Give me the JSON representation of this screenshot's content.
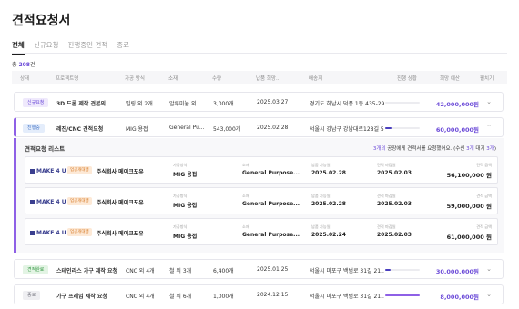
{
  "page": {
    "title": "견적요청서"
  },
  "tabs": [
    {
      "label": "전체",
      "active": true
    },
    {
      "label": "신규요청",
      "active": false
    },
    {
      "label": "진행중인 견적",
      "active": false
    },
    {
      "label": "종료",
      "active": false
    }
  ],
  "summary": {
    "prefix": "총 ",
    "count": "208",
    "suffix": "건"
  },
  "columns": [
    "상태",
    "프로젝트명",
    "가공 방식",
    "소재",
    "수량",
    "납품 희망...",
    "배송지",
    "진행 상황",
    "희망 예산",
    "펼치기"
  ],
  "rows": [
    {
      "status": "신규요청",
      "status_kind": "new",
      "project": "3D 드론 제작 견본의",
      "method": "밀링 외 2개",
      "material": "알루미늄 외...",
      "qty": "3,000개",
      "date": "2025.03.27",
      "address": "경기도 하남시 덕풍 1동 435-29...",
      "progress": 0.0,
      "progress_color": "#ececf0",
      "budget": "42,000,000원",
      "chevron": "⌄"
    },
    {
      "status": "진행중",
      "status_kind": "prog",
      "project": "레진/CNC 견적요청",
      "method": "MIG 용접",
      "material": "General Pu...",
      "qty": "543,000개",
      "date": "2025.02.28",
      "address": "서울시 강남구 강남대로128길 5...",
      "progress": 0.18,
      "progress_color": "#4a3fbf",
      "budget": "60,000,000원",
      "chevron": "⌃"
    },
    {
      "status": "견적완료",
      "status_kind": "done",
      "project": "스테인리스 가구 제작 요청",
      "method": "CNC 외 4개",
      "material": "철 외 3개",
      "qty": "6,400개",
      "date": "2025.01.25",
      "address": "서울시 마포구 백범로 31길 21...",
      "progress": 0.15,
      "progress_color": "#4a3fbf",
      "budget": "30,000,000원",
      "chevron": "⌄"
    },
    {
      "status": "종료",
      "status_kind": "end",
      "project": "가구 프레임 제작 요청",
      "method": "CNC 외 4개",
      "material": "철 외 6개",
      "qty": "1,000개",
      "date": "2024.12.15",
      "address": "서울시 마포구 백범로 31길 21...",
      "progress": 1.0,
      "progress_color": "#8e60e6",
      "budget": "8,000,000원",
      "chevron": "⌄"
    }
  ],
  "panel": {
    "title": "견적요청 리스트",
    "note_prefix": "3개의",
    "note_middle": " 공장에게 견적서를 요청했어요. (수신 ",
    "note_recv": "3개",
    "note_sep": " 대기 ",
    "note_wait": "3개",
    "note_end": ")",
    "quotes": [
      {
        "logo": "MAKE 4 U",
        "badge": "업공개대행",
        "company": "주식회사 메이크포유",
        "method_label": "가공방식",
        "method": "MIG 용접",
        "material_label": "소재",
        "material": "General Purpose...",
        "due_label": "납품 가능일",
        "due": "2025.02.28",
        "deadline_label": "견적 마감일",
        "deadline": "2025.02.03",
        "amount_label": "견적 금액",
        "amount": "56,100,000 원"
      },
      {
        "logo": "MAKE 4 U",
        "badge": "업공개대행",
        "company": "주식회사 메이크포유",
        "method_label": "가공방식",
        "method": "MIG 용접",
        "material_label": "소재",
        "material": "General Purpose...",
        "due_label": "납품 가능일",
        "due": "2025.02.28",
        "deadline_label": "견적 마감일",
        "deadline": "2025.02.03",
        "amount_label": "견적 금액",
        "amount": "59,000,000 원"
      },
      {
        "logo": "MAKE 4 U",
        "badge": "업공개대행",
        "company": "주식회사 메이크포유",
        "method_label": "가공방식",
        "method": "MIG 용접",
        "material_label": "소재",
        "material": "General Purpose...",
        "due_label": "납품 가능일",
        "due": "2025.02.24",
        "deadline_label": "견적 마감일",
        "deadline": "2025.02.03",
        "amount_label": "견적 금액",
        "amount": "61,000,000 원"
      }
    ]
  }
}
